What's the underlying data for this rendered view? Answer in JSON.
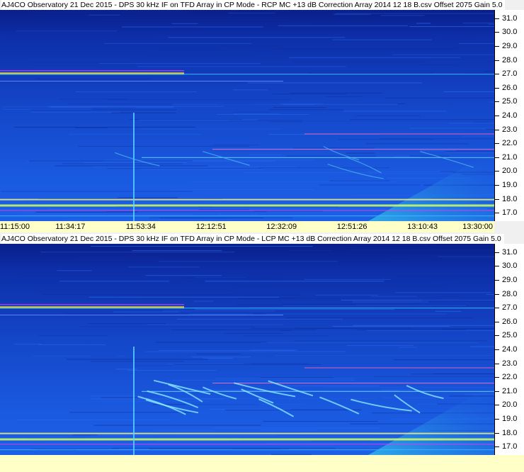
{
  "chart_data": [
    {
      "type": "heatmap",
      "title": "AJ4CO Observatory 21 Dec 2015 - DPS 30 kHz IF on TFD Array in CP Mode - RCP  MC +13 dB  Correction Array 2014 12 18 B.csv  Offset 2075  Gain 5.0",
      "x_tick_labels": [
        "11:15:00",
        "11:34:17",
        "11:53:34",
        "12:12:51",
        "12:32:09",
        "12:51:26",
        "13:10:43",
        "13:30:00"
      ],
      "y_tick_labels": [
        "31.0",
        "30.0",
        "29.0",
        "28.0",
        "27.0",
        "26.0",
        "25.0",
        "24.0",
        "23.0",
        "22.0",
        "21.0",
        "20.0",
        "19.0",
        "18.0",
        "17.0"
      ],
      "ylim": [
        16.4,
        31.6
      ]
    },
    {
      "type": "heatmap",
      "title": "AJ4CO Observatory 21 Dec 2015 - DPS 30 kHz IF on TFD Array in CP Mode - LCP  MC +13 dB  Correction Array 2014 12 18 B.csv  Offset 2075  Gain 5.0",
      "x_tick_labels": [],
      "y_tick_labels": [
        "31.0",
        "30.0",
        "29.0",
        "28.0",
        "27.0",
        "26.0",
        "25.0",
        "24.0",
        "23.0",
        "22.0",
        "21.0",
        "20.0",
        "19.0",
        "18.0",
        "17.0"
      ],
      "ylim": [
        16.4,
        31.6
      ]
    }
  ]
}
